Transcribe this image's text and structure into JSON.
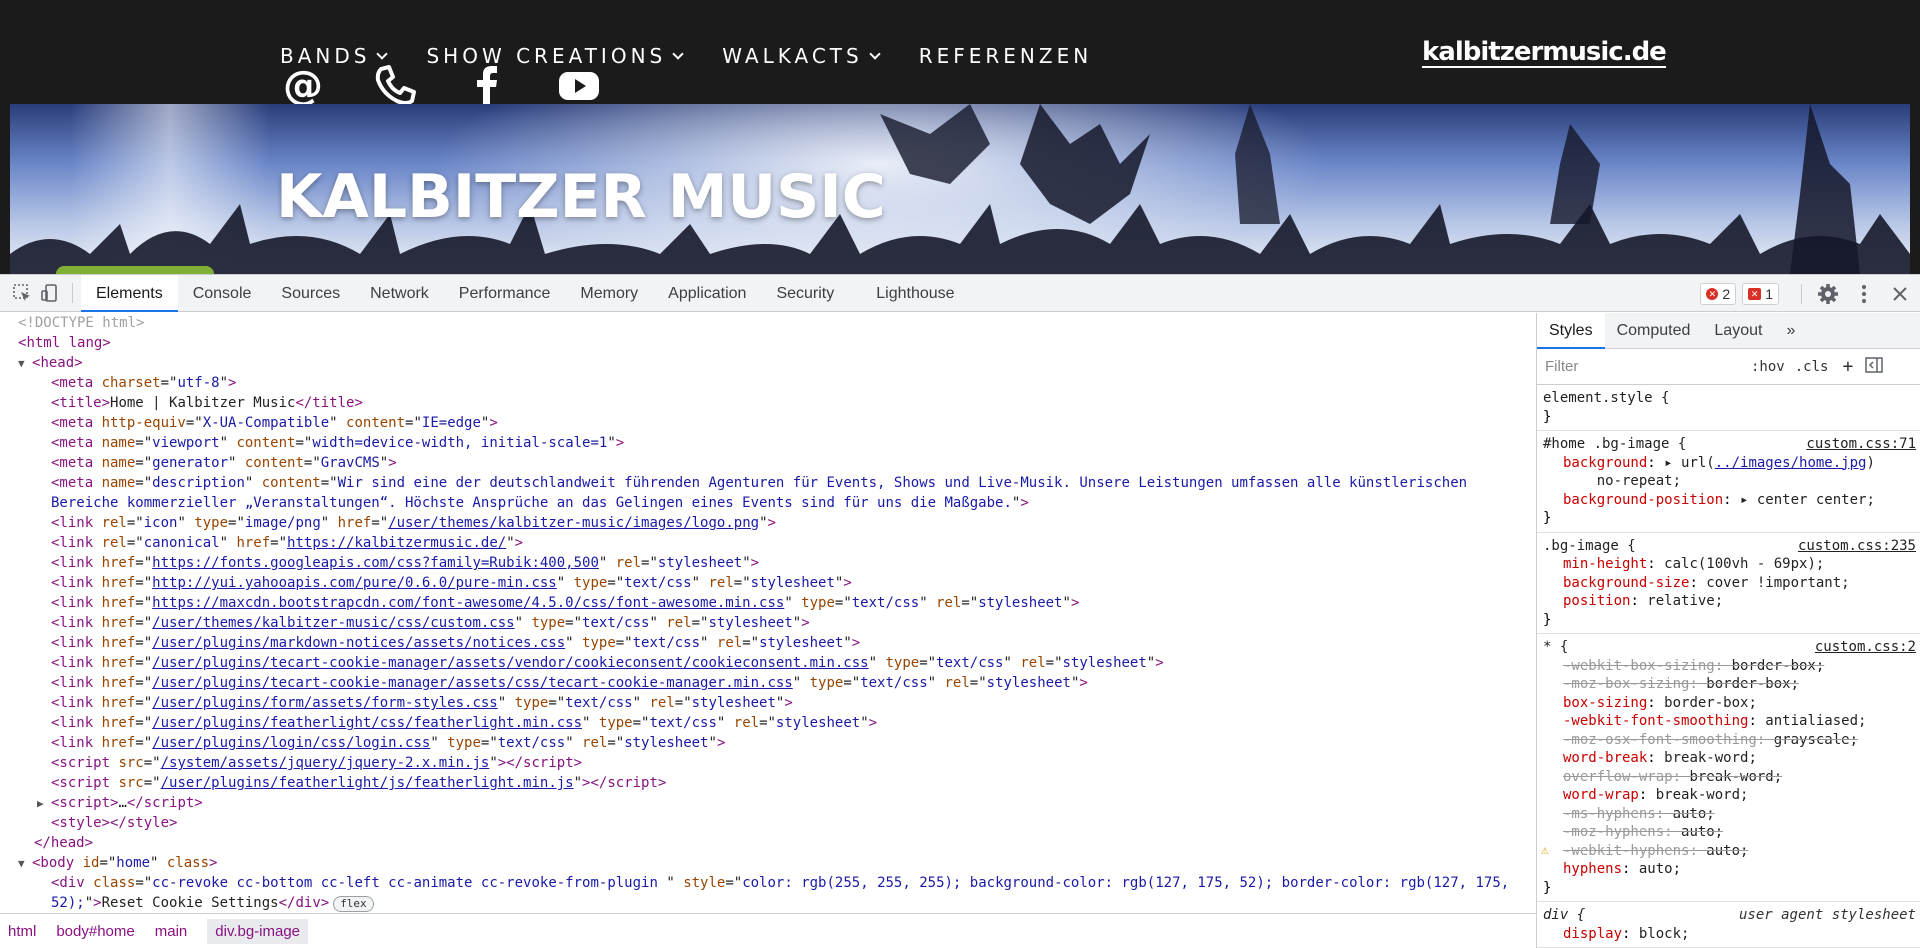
{
  "site": {
    "nav": [
      {
        "label": "BANDS",
        "dropdown": true
      },
      {
        "label": "SHOW CREATIONS",
        "dropdown": true
      },
      {
        "label": "WALKACTS",
        "dropdown": true
      },
      {
        "label": "REFERENZEN",
        "dropdown": false
      }
    ],
    "logo": "kalbitzermusic.de",
    "social_icons": [
      "at-icon",
      "phone-icon",
      "facebook-icon",
      "youtube-icon"
    ],
    "hero_title": "KALBITZER MUSIC",
    "accent_color": "#7faf34"
  },
  "devtools": {
    "tabs": [
      "Elements",
      "Console",
      "Sources",
      "Network",
      "Performance",
      "Memory",
      "Application",
      "Security",
      "Lighthouse"
    ],
    "active_tab": "Elements",
    "error_count": "2",
    "issue_count": "1",
    "breadcrumbs": [
      "html",
      "body#home",
      "main",
      "div.bg-image"
    ],
    "styles_tabs": [
      "Styles",
      "Computed",
      "Layout",
      "»"
    ],
    "filter_placeholder": "Filter",
    "hov": ":hov",
    "cls": ".cls",
    "dom": {
      "doctype": "<!DOCTYPE html>",
      "html_open": "html lang",
      "head": "head",
      "meta_charset": {
        "tag": "meta",
        "attr": "charset",
        "val": "utf-8"
      },
      "title_text": "Home | Kalbitzer Music",
      "meta_xua": {
        "attr1": "http-equiv",
        "val1": "X-UA-Compatible",
        "attr2": "content",
        "val2": "IE=edge"
      },
      "meta_viewport": {
        "attr1": "name",
        "val1": "viewport",
        "attr2": "content",
        "val2": "width=device-width, initial-scale=1"
      },
      "meta_generator": {
        "attr1": "name",
        "val1": "generator",
        "attr2": "content",
        "val2": "GravCMS"
      },
      "meta_desc": {
        "attr1": "name",
        "val1": "description",
        "attr2": "content",
        "val2": "Wir sind eine der deutschlandweit führenden Agenturen für Events, Shows und Live-Musik. Unsere Leistungen umfassen alle künstlerischen Bereiche kommerzieller „Veranstaltungen“. Höchste Ansprüche an das Gelingen eines Events sind für uns die Maßgabe."
      },
      "link_icon": {
        "rel": "icon",
        "type": "image/png",
        "href": "/user/themes/kalbitzer-music/images/logo.png"
      },
      "link_canonical": {
        "rel": "canonical",
        "href": "https://kalbitzermusic.de/"
      },
      "links": [
        {
          "href": "https://fonts.googleapis.com/css?family=Rubik:400,500",
          "type": "",
          "rel": "stylesheet"
        },
        {
          "href": "http://yui.yahooapis.com/pure/0.6.0/pure-min.css",
          "type": "text/css",
          "rel": "stylesheet"
        },
        {
          "href": "https://maxcdn.bootstrapcdn.com/font-awesome/4.5.0/css/font-awesome.min.css",
          "type": "text/css",
          "rel": "stylesheet"
        },
        {
          "href": "/user/themes/kalbitzer-music/css/custom.css",
          "type": "text/css",
          "rel": "stylesheet"
        },
        {
          "href": "/user/plugins/markdown-notices/assets/notices.css",
          "type": "text/css",
          "rel": "stylesheet"
        },
        {
          "href": "/user/plugins/tecart-cookie-manager/assets/vendor/cookieconsent/cookieconsent.min.css",
          "type": "text/css",
          "rel": "stylesheet"
        },
        {
          "href": "/user/plugins/tecart-cookie-manager/assets/css/tecart-cookie-manager.min.css",
          "type": "text/css",
          "rel": "stylesheet"
        },
        {
          "href": "/user/plugins/form/assets/form-styles.css",
          "type": "text/css",
          "rel": "stylesheet"
        },
        {
          "href": "/user/plugins/featherlight/css/featherlight.min.css",
          "type": "text/css",
          "rel": "stylesheet"
        },
        {
          "href": "/user/plugins/login/css/login.css",
          "type": "text/css",
          "rel": "stylesheet"
        }
      ],
      "scripts": [
        {
          "src": "/system/assets/jquery/jquery-2.x.min.js"
        },
        {
          "src": "/user/plugins/featherlight/js/featherlight.min.js"
        }
      ],
      "script_collapsed": "…",
      "body_id": "home",
      "body_class": "class",
      "div_class": "cc-revoke cc-bottom cc-left cc-animate cc-revoke-from-plugin ",
      "div_style": "color: rgb(255, 255, 255); background-color: rgb(127, 175, 52); border-color: rgb(127, 175, 52);",
      "div_text": "Reset Cookie Settings",
      "flex_badge": "flex"
    },
    "styles": {
      "element_style": "element.style {",
      "rules": [
        {
          "selector": "#home .bg-image {",
          "source": "custom.css:71",
          "decls": [
            {
              "name": "background",
              "value_prefix": "▸ url(",
              "link": "../images/home.jpg",
              "value_suffix": ")",
              "struck": false
            },
            {
              "name": "",
              "value_prefix": "    no-repeat;",
              "link": "",
              "value_suffix": "",
              "struck": false,
              "continuation": true
            },
            {
              "name": "background-position",
              "value_prefix": "▸ center center;",
              "link": "",
              "value_suffix": "",
              "struck": false
            }
          ]
        },
        {
          "selector": ".bg-image {",
          "source": "custom.css:235",
          "decls": [
            {
              "name": "min-height",
              "value_prefix": "calc(100vh - 69px);",
              "link": "",
              "value_suffix": "",
              "struck": false
            },
            {
              "name": "background-size",
              "value_prefix": "cover !important;",
              "link": "",
              "value_suffix": "",
              "struck": false
            },
            {
              "name": "position",
              "value_prefix": "relative;",
              "link": "",
              "value_suffix": "",
              "struck": false
            }
          ]
        },
        {
          "selector": "* {",
          "source": "custom.css:2",
          "decls": [
            {
              "name": "-webkit-box-sizing",
              "value_prefix": "border-box;",
              "link": "",
              "value_suffix": "",
              "struck": true
            },
            {
              "name": "-moz-box-sizing",
              "value_prefix": "border-box;",
              "link": "",
              "value_suffix": "",
              "struck": true
            },
            {
              "name": "box-sizing",
              "value_prefix": "border-box;",
              "link": "",
              "value_suffix": "",
              "struck": false
            },
            {
              "name": "-webkit-font-smoothing",
              "value_prefix": "antialiased;",
              "link": "",
              "value_suffix": "",
              "struck": false
            },
            {
              "name": "-moz-osx-font-smoothing",
              "value_prefix": "grayscale;",
              "link": "",
              "value_suffix": "",
              "struck": true
            },
            {
              "name": "word-break",
              "value_prefix": "break-word;",
              "link": "",
              "value_suffix": "",
              "struck": false
            },
            {
              "name": "overflow-wrap",
              "value_prefix": "break-word;",
              "link": "",
              "value_suffix": "",
              "struck": true
            },
            {
              "name": "word-wrap",
              "value_prefix": "break-word;",
              "link": "",
              "value_suffix": "",
              "struck": false
            },
            {
              "name": "-ms-hyphens",
              "value_prefix": "auto;",
              "link": "",
              "value_suffix": "",
              "struck": true
            },
            {
              "name": "-moz-hyphens",
              "value_prefix": "auto;",
              "link": "",
              "value_suffix": "",
              "struck": true
            },
            {
              "name": "-webkit-hyphens",
              "value_prefix": "auto;",
              "link": "",
              "value_suffix": "",
              "struck": true,
              "warn": true
            },
            {
              "name": "hyphens",
              "value_prefix": "auto;",
              "link": "",
              "value_suffix": "",
              "struck": false
            }
          ]
        },
        {
          "selector": "div {",
          "source": "user agent stylesheet",
          "ua": true,
          "decls": [
            {
              "name": "display",
              "value_prefix": "block;",
              "link": "",
              "value_suffix": "",
              "struck": false
            }
          ]
        }
      ]
    }
  }
}
